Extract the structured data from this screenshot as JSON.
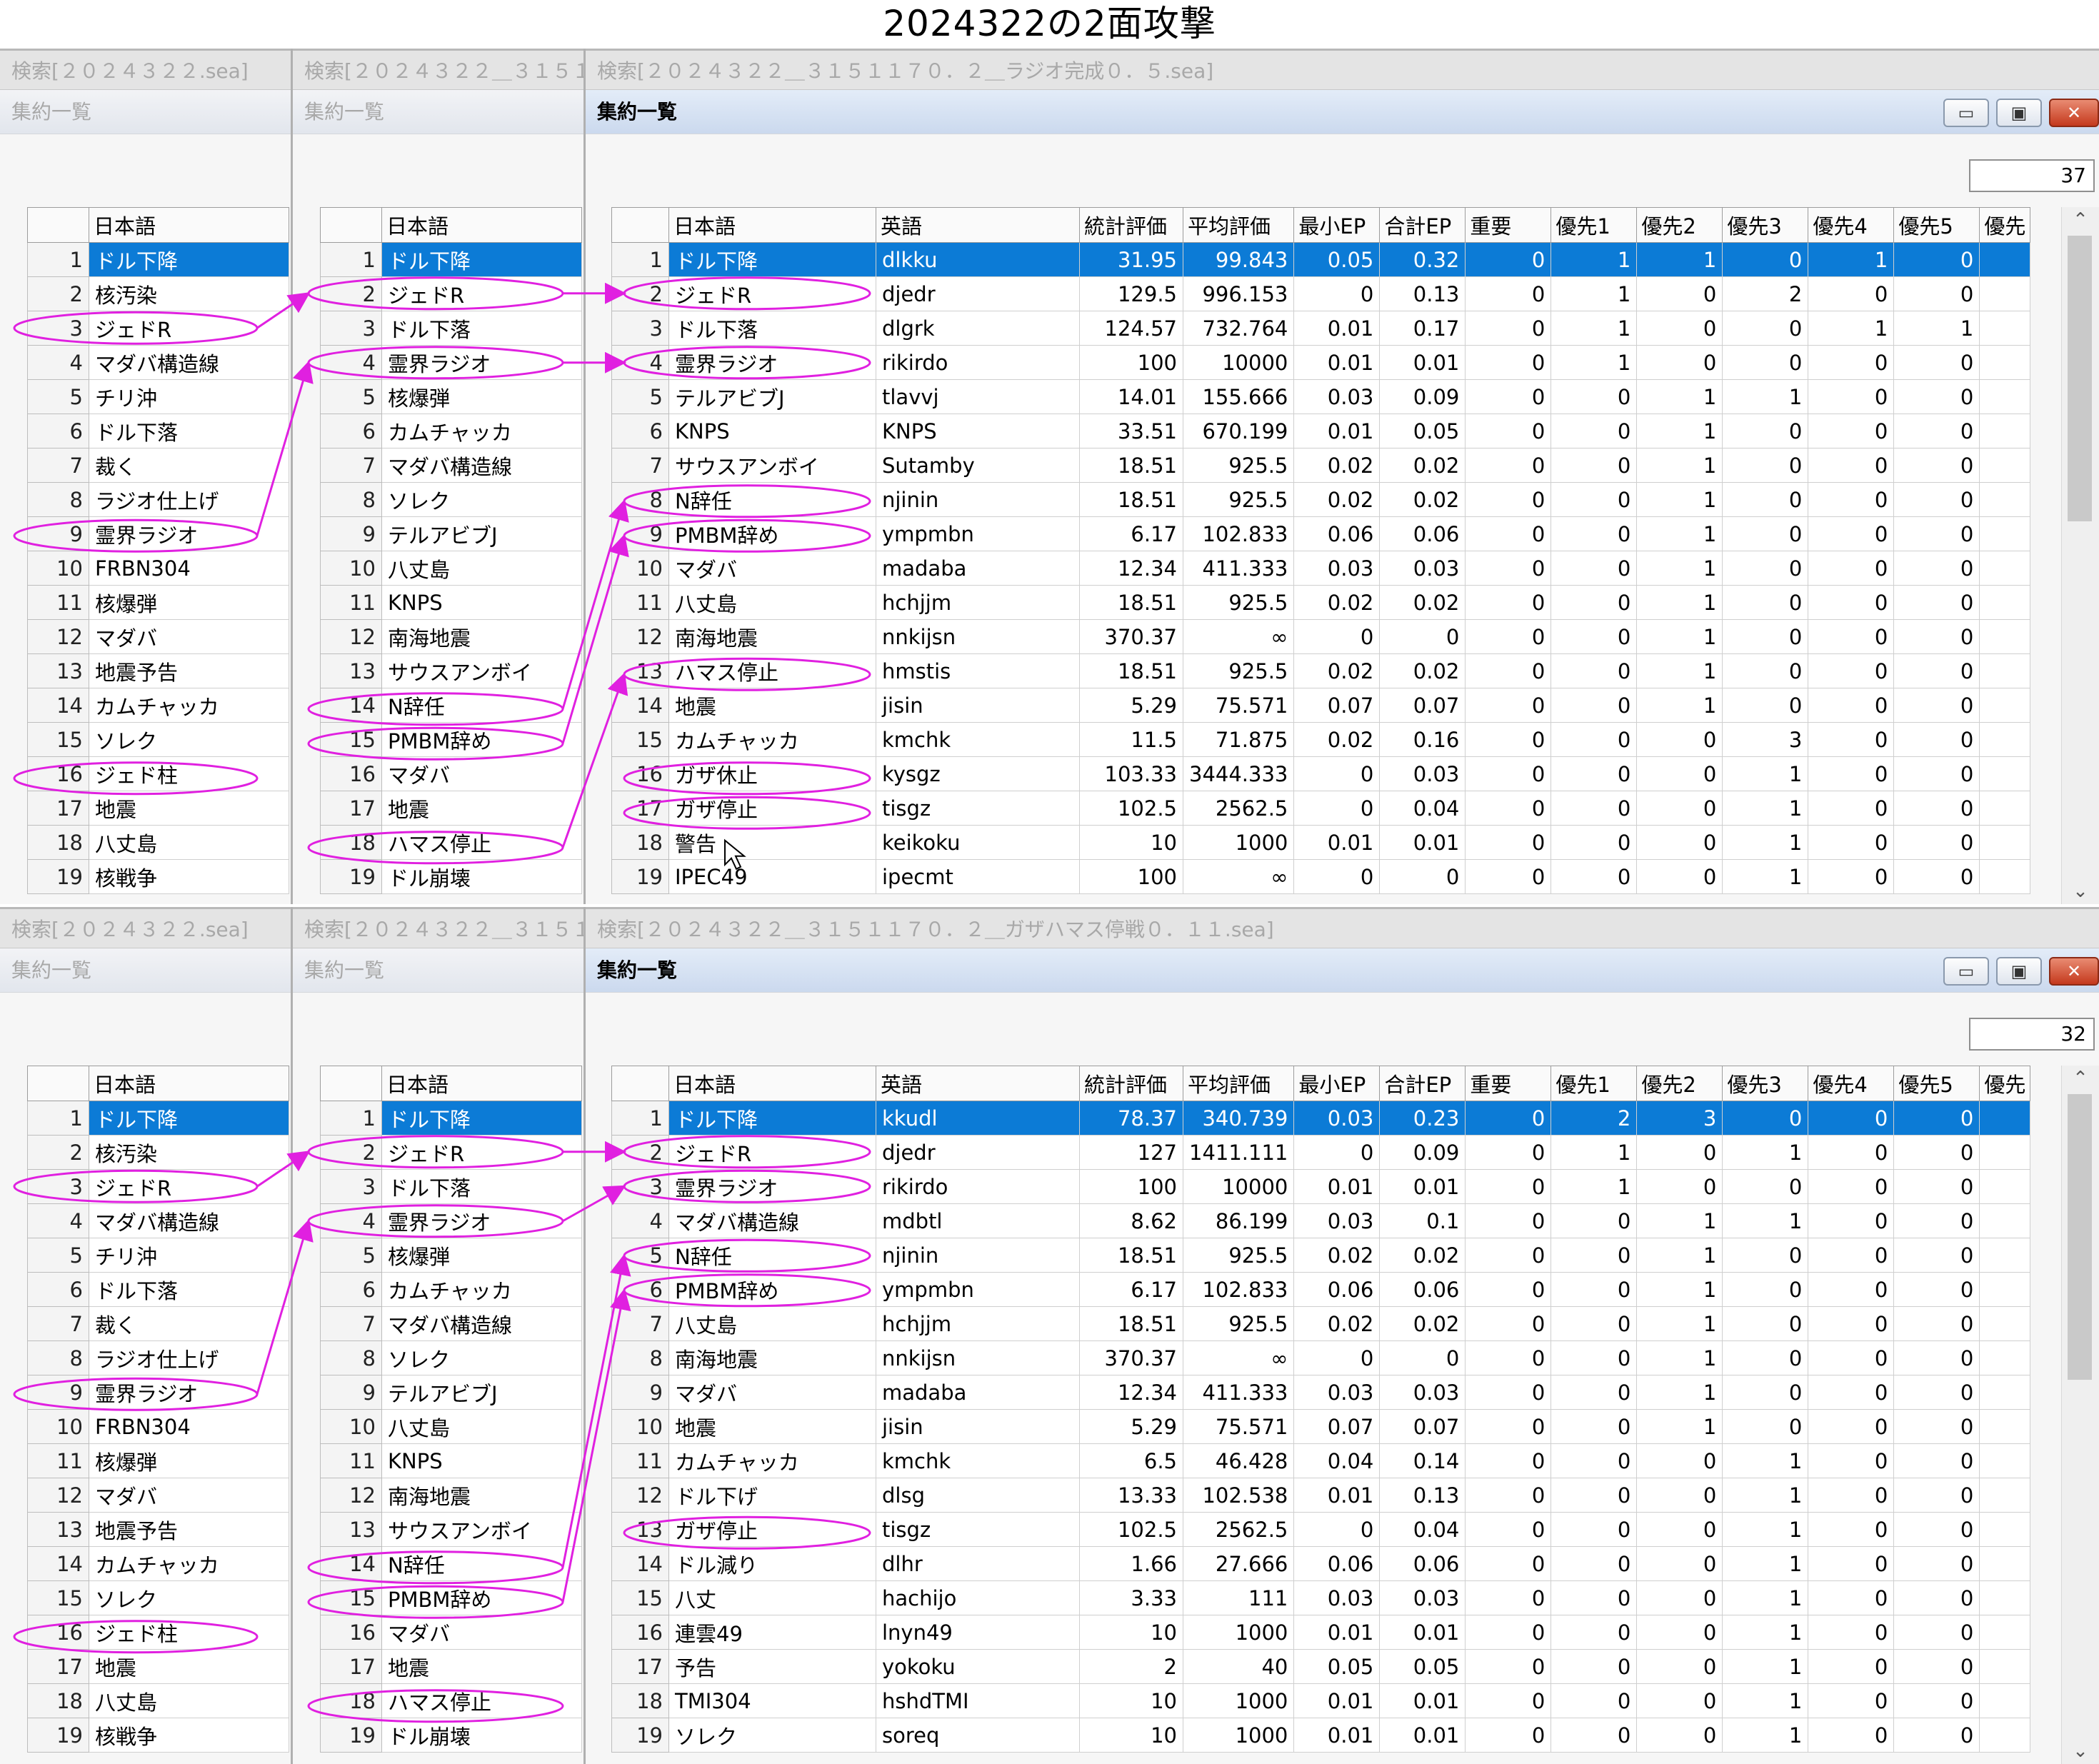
{
  "title": "2024322の2面攻撃",
  "panels": [
    {
      "tab1": "検索[２０２４３２２.sea]",
      "tab2": "検索[２０２４３２２＿３１５１",
      "tab3": "検索[２０２４３２２＿３１５１１７０．２＿ラジオ完成０．５.sea]",
      "sub1": "集約一覧",
      "sub2": "集約一覧",
      "sub3": "集約一覧",
      "count": "37",
      "col1_rows": [
        "ドル下降",
        "核汚染",
        "ジェドR",
        "マダバ構造線",
        "チリ沖",
        "ドル下落",
        "裁く",
        "ラジオ仕上げ",
        "霊界ラジオ",
        "FRBN304",
        "核爆弾",
        "マダバ",
        "地震予告",
        "カムチャッカ",
        "ソレク",
        "ジェド柱",
        "地震",
        "八丈島",
        "核戦争"
      ],
      "col2_rows": [
        "ドル下降",
        "ジェドR",
        "ドル下落",
        "霊界ラジオ",
        "核爆弾",
        "カムチャッカ",
        "マダバ構造線",
        "ソレク",
        "テルアビブJ",
        "八丈島",
        "KNPS",
        "南海地震",
        "サウスアンボイ",
        "N辞任",
        "PMBM辞め",
        "マダバ",
        "地震",
        "ハマス停止",
        "ドル崩壊"
      ],
      "main_rows": [
        [
          "ドル下降",
          "dlkku",
          "31.95",
          "99.843",
          "0.05",
          "0.32",
          "0",
          "1",
          "1",
          "0",
          "1",
          "0"
        ],
        [
          "ジェドR",
          "djedr",
          "129.5",
          "996.153",
          "0",
          "0.13",
          "0",
          "1",
          "0",
          "2",
          "0",
          "0"
        ],
        [
          "ドル下落",
          "dlgrk",
          "124.57",
          "732.764",
          "0.01",
          "0.17",
          "0",
          "1",
          "0",
          "0",
          "1",
          "1"
        ],
        [
          "霊界ラジオ",
          "rikirdo",
          "100",
          "10000",
          "0.01",
          "0.01",
          "0",
          "1",
          "0",
          "0",
          "0",
          "0"
        ],
        [
          "テルアビブJ",
          "tlavvj",
          "14.01",
          "155.666",
          "0.03",
          "0.09",
          "0",
          "0",
          "1",
          "1",
          "0",
          "0"
        ],
        [
          "KNPS",
          "KNPS",
          "33.51",
          "670.199",
          "0.01",
          "0.05",
          "0",
          "0",
          "1",
          "0",
          "0",
          "0"
        ],
        [
          "サウスアンボイ",
          "Sutamby",
          "18.51",
          "925.5",
          "0.02",
          "0.02",
          "0",
          "0",
          "1",
          "0",
          "0",
          "0"
        ],
        [
          "N辞任",
          "njinin",
          "18.51",
          "925.5",
          "0.02",
          "0.02",
          "0",
          "0",
          "1",
          "0",
          "0",
          "0"
        ],
        [
          "PMBM辞め",
          "ympmbn",
          "6.17",
          "102.833",
          "0.06",
          "0.06",
          "0",
          "0",
          "1",
          "0",
          "0",
          "0"
        ],
        [
          "マダバ",
          "madaba",
          "12.34",
          "411.333",
          "0.03",
          "0.03",
          "0",
          "0",
          "1",
          "0",
          "0",
          "0"
        ],
        [
          "八丈島",
          "hchjjm",
          "18.51",
          "925.5",
          "0.02",
          "0.02",
          "0",
          "0",
          "1",
          "0",
          "0",
          "0"
        ],
        [
          "南海地震",
          "nnkijsn",
          "370.37",
          "∞",
          "0",
          "0",
          "0",
          "0",
          "1",
          "0",
          "0",
          "0"
        ],
        [
          "ハマス停止",
          "hmstis",
          "18.51",
          "925.5",
          "0.02",
          "0.02",
          "0",
          "0",
          "1",
          "0",
          "0",
          "0"
        ],
        [
          "地震",
          "jisin",
          "5.29",
          "75.571",
          "0.07",
          "0.07",
          "0",
          "0",
          "1",
          "0",
          "0",
          "0"
        ],
        [
          "カムチャッカ",
          "kmchk",
          "11.5",
          "71.875",
          "0.02",
          "0.16",
          "0",
          "0",
          "0",
          "3",
          "0",
          "0"
        ],
        [
          "ガザ休止",
          "kysgz",
          "103.33",
          "3444.333",
          "0",
          "0.03",
          "0",
          "0",
          "0",
          "1",
          "0",
          "0"
        ],
        [
          "ガザ停止",
          "tisgz",
          "102.5",
          "2562.5",
          "0",
          "0.04",
          "0",
          "0",
          "0",
          "1",
          "0",
          "0"
        ],
        [
          "警告",
          "keikoku",
          "10",
          "1000",
          "0.01",
          "0.01",
          "0",
          "0",
          "0",
          "1",
          "0",
          "0"
        ],
        [
          "IPEC49",
          "ipecmt",
          "100",
          "∞",
          "0",
          "0",
          "0",
          "0",
          "0",
          "1",
          "0",
          "0"
        ]
      ]
    },
    {
      "tab1": "検索[２０２４３２２.sea]",
      "tab2": "検索[２０２４３２２＿３１５１",
      "tab3": "検索[２０２４３２２＿３１５１１７０．２＿ガザハマス停戦０．１１.sea]",
      "sub1": "集約一覧",
      "sub2": "集約一覧",
      "sub3": "集約一覧",
      "count": "32",
      "col1_rows": [
        "ドル下降",
        "核汚染",
        "ジェドR",
        "マダバ構造線",
        "チリ沖",
        "ドル下落",
        "裁く",
        "ラジオ仕上げ",
        "霊界ラジオ",
        "FRBN304",
        "核爆弾",
        "マダバ",
        "地震予告",
        "カムチャッカ",
        "ソレク",
        "ジェド柱",
        "地震",
        "八丈島",
        "核戦争"
      ],
      "col2_rows": [
        "ドル下降",
        "ジェドR",
        "ドル下落",
        "霊界ラジオ",
        "核爆弾",
        "カムチャッカ",
        "マダバ構造線",
        "ソレク",
        "テルアビブJ",
        "八丈島",
        "KNPS",
        "南海地震",
        "サウスアンボイ",
        "N辞任",
        "PMBM辞め",
        "マダバ",
        "地震",
        "ハマス停止",
        "ドル崩壊"
      ],
      "main_rows": [
        [
          "ドル下降",
          "kkudl",
          "78.37",
          "340.739",
          "0.03",
          "0.23",
          "0",
          "2",
          "3",
          "0",
          "0",
          "0"
        ],
        [
          "ジェドR",
          "djedr",
          "127",
          "1411.111",
          "0",
          "0.09",
          "0",
          "1",
          "0",
          "1",
          "0",
          "0"
        ],
        [
          "霊界ラジオ",
          "rikirdo",
          "100",
          "10000",
          "0.01",
          "0.01",
          "0",
          "1",
          "0",
          "0",
          "0",
          "0"
        ],
        [
          "マダバ構造線",
          "mdbtl",
          "8.62",
          "86.199",
          "0.03",
          "0.1",
          "0",
          "0",
          "1",
          "1",
          "0",
          "0"
        ],
        [
          "N辞任",
          "njinin",
          "18.51",
          "925.5",
          "0.02",
          "0.02",
          "0",
          "0",
          "1",
          "0",
          "0",
          "0"
        ],
        [
          "PMBM辞め",
          "ympmbn",
          "6.17",
          "102.833",
          "0.06",
          "0.06",
          "0",
          "0",
          "1",
          "0",
          "0",
          "0"
        ],
        [
          "八丈島",
          "hchjjm",
          "18.51",
          "925.5",
          "0.02",
          "0.02",
          "0",
          "0",
          "1",
          "0",
          "0",
          "0"
        ],
        [
          "南海地震",
          "nnkijsn",
          "370.37",
          "∞",
          "0",
          "0",
          "0",
          "0",
          "1",
          "0",
          "0",
          "0"
        ],
        [
          "マダバ",
          "madaba",
          "12.34",
          "411.333",
          "0.03",
          "0.03",
          "0",
          "0",
          "1",
          "0",
          "0",
          "0"
        ],
        [
          "地震",
          "jisin",
          "5.29",
          "75.571",
          "0.07",
          "0.07",
          "0",
          "0",
          "1",
          "0",
          "0",
          "0"
        ],
        [
          "カムチャッカ",
          "kmchk",
          "6.5",
          "46.428",
          "0.04",
          "0.14",
          "0",
          "0",
          "0",
          "1",
          "0",
          "0"
        ],
        [
          "ドル下げ",
          "dlsg",
          "13.33",
          "102.538",
          "0.01",
          "0.13",
          "0",
          "0",
          "0",
          "1",
          "0",
          "0"
        ],
        [
          "ガザ停止",
          "tisgz",
          "102.5",
          "2562.5",
          "0",
          "0.04",
          "0",
          "0",
          "0",
          "1",
          "0",
          "0"
        ],
        [
          "ドル減り",
          "dlhr",
          "1.66",
          "27.666",
          "0.06",
          "0.06",
          "0",
          "0",
          "0",
          "1",
          "0",
          "0"
        ],
        [
          "八丈",
          "hachijo",
          "3.33",
          "111",
          "0.03",
          "0.03",
          "0",
          "0",
          "0",
          "1",
          "0",
          "0"
        ],
        [
          "連雲49",
          "lnyn49",
          "10",
          "1000",
          "0.01",
          "0.01",
          "0",
          "0",
          "0",
          "1",
          "0",
          "0"
        ],
        [
          "予告",
          "yokoku",
          "2",
          "40",
          "0.05",
          "0.05",
          "0",
          "0",
          "0",
          "1",
          "0",
          "0"
        ],
        [
          "TMI304",
          "hshdTMI",
          "10",
          "1000",
          "0.01",
          "0.01",
          "0",
          "0",
          "0",
          "1",
          "0",
          "0"
        ],
        [
          "ソレク",
          "soreq",
          "10",
          "1000",
          "0.01",
          "0.01",
          "0",
          "0",
          "0",
          "1",
          "0",
          "0"
        ]
      ]
    }
  ],
  "col_header_jp": "日本語",
  "main_headers": [
    "日本語",
    "英語",
    "統計評価",
    "平均評価",
    "最小EP",
    "合計EP",
    "重要",
    "優先1",
    "優先2",
    "優先3",
    "優先4",
    "優先5",
    "優先"
  ],
  "icons": {
    "minimize": "minimize-icon",
    "maximize": "maximize-icon",
    "close": "close-icon",
    "scroll_up": "scroll-up-icon",
    "scroll_down": "scroll-down-icon",
    "cursor": "mouse-cursor-icon"
  },
  "colors": {
    "selection": "#0c7bd6",
    "highlight_ellipse": "#e020e0",
    "close_button": "#c4391d"
  }
}
